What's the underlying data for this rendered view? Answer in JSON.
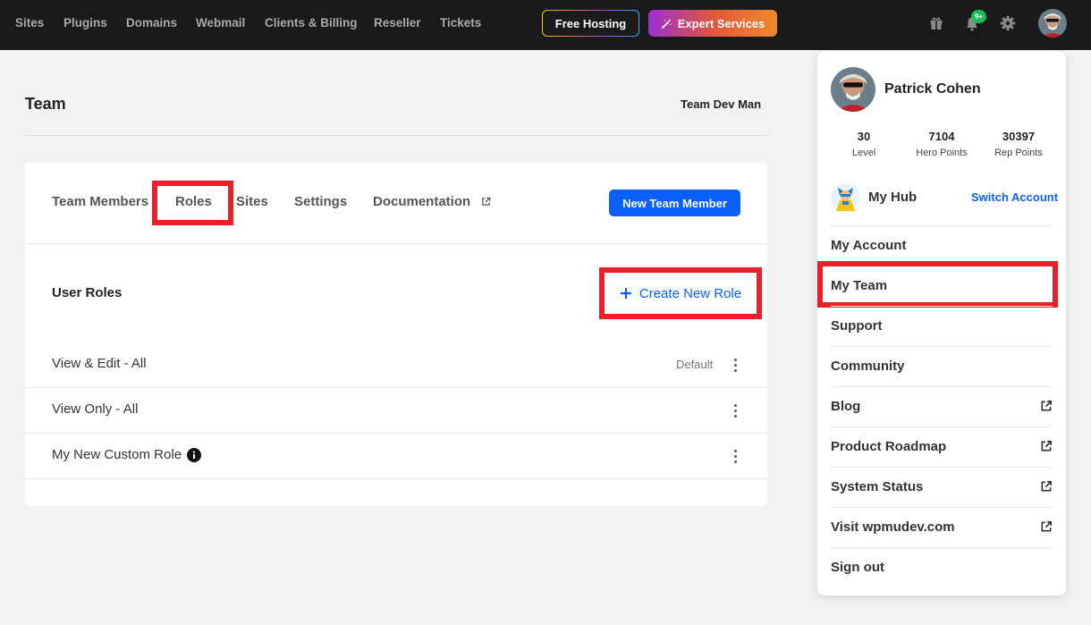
{
  "topnav": {
    "items": [
      "Sites",
      "Plugins",
      "Domains",
      "Webmail",
      "Clients & Billing",
      "Reseller",
      "Tickets"
    ],
    "free_hosting": "Free Hosting",
    "expert_services": "Expert Services",
    "notification_badge": "9+"
  },
  "page": {
    "title": "Team",
    "team_name": "Team Dev Man"
  },
  "tabs": [
    "Team Members",
    "Roles",
    "Sites",
    "Settings",
    "Documentation"
  ],
  "new_team_member": "New Team Member",
  "roles": {
    "section_title": "User Roles",
    "create_button": "Create New Role",
    "rows": [
      {
        "name": "View & Edit - All",
        "badge": "Default"
      },
      {
        "name": "View Only - All",
        "badge": ""
      },
      {
        "name": "My New Custom Role",
        "badge": ""
      }
    ]
  },
  "profile": {
    "name": "Patrick Cohen",
    "stats": [
      {
        "value": "30",
        "label": "Level"
      },
      {
        "value": "7104",
        "label": "Hero Points"
      },
      {
        "value": "30397",
        "label": "Rep Points"
      }
    ],
    "hub_label": "My Hub",
    "switch_account": "Switch Account",
    "menu": [
      {
        "label": "My Account",
        "external": false
      },
      {
        "label": "My Team",
        "external": false
      },
      {
        "label": "Support",
        "external": false
      },
      {
        "label": "Community",
        "external": false
      },
      {
        "label": "Blog",
        "external": true
      },
      {
        "label": "Product Roadmap",
        "external": true
      },
      {
        "label": "System Status",
        "external": true
      },
      {
        "label": "Visit wpmudev.com",
        "external": true
      },
      {
        "label": "Sign out",
        "external": false
      }
    ]
  },
  "colors": {
    "accent": "#0b5fff",
    "highlight": "#e8202a",
    "topbar": "#1a1a1a"
  }
}
